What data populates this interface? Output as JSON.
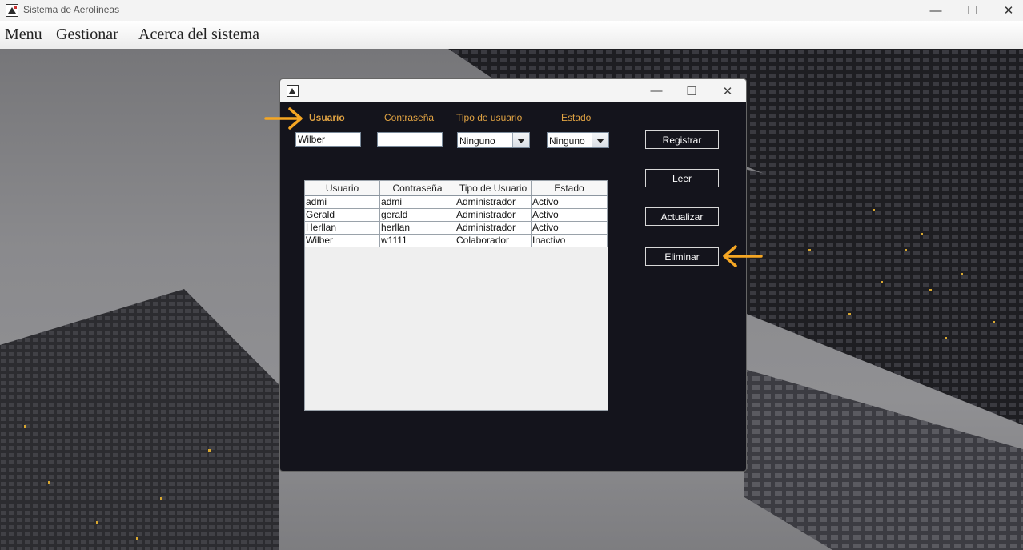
{
  "window": {
    "title": "Sistema de Aerolíneas",
    "minimize_glyph": "—",
    "maximize_glyph": "☐",
    "close_glyph": "✕"
  },
  "menubar": {
    "items": [
      "Menu",
      "Gestionar",
      "Acerca del sistema"
    ]
  },
  "internal_frame": {
    "minimize_glyph": "—",
    "maximize_glyph": "☐",
    "close_glyph": "✕"
  },
  "form": {
    "labels": {
      "usuario": "Usuario",
      "contrasena": "Contraseña",
      "tipo": "Tipo de usuario",
      "estado": "Estado"
    },
    "usuario_value": "Wilber",
    "contrasena_value": "",
    "tipo_selected": "Ninguno",
    "estado_selected": "Ninguno",
    "label_color": "#e2a443"
  },
  "buttons": [
    "Registrar",
    "Leer",
    "Actualizar",
    "Eliminar"
  ],
  "table": {
    "columns": [
      "Usuario",
      "Contraseña",
      "Tipo de Usuario",
      "Estado"
    ],
    "rows": [
      [
        "admi",
        "admi",
        "Administrador",
        "Activo"
      ],
      [
        "Gerald",
        "gerald",
        "Administrador",
        "Activo"
      ],
      [
        "Herllan",
        "herllan",
        "Administrador",
        "Activo"
      ],
      [
        "Wilber",
        "w1111",
        "Colaborador",
        "Inactivo"
      ]
    ]
  },
  "annotation_color": "#f5a623"
}
